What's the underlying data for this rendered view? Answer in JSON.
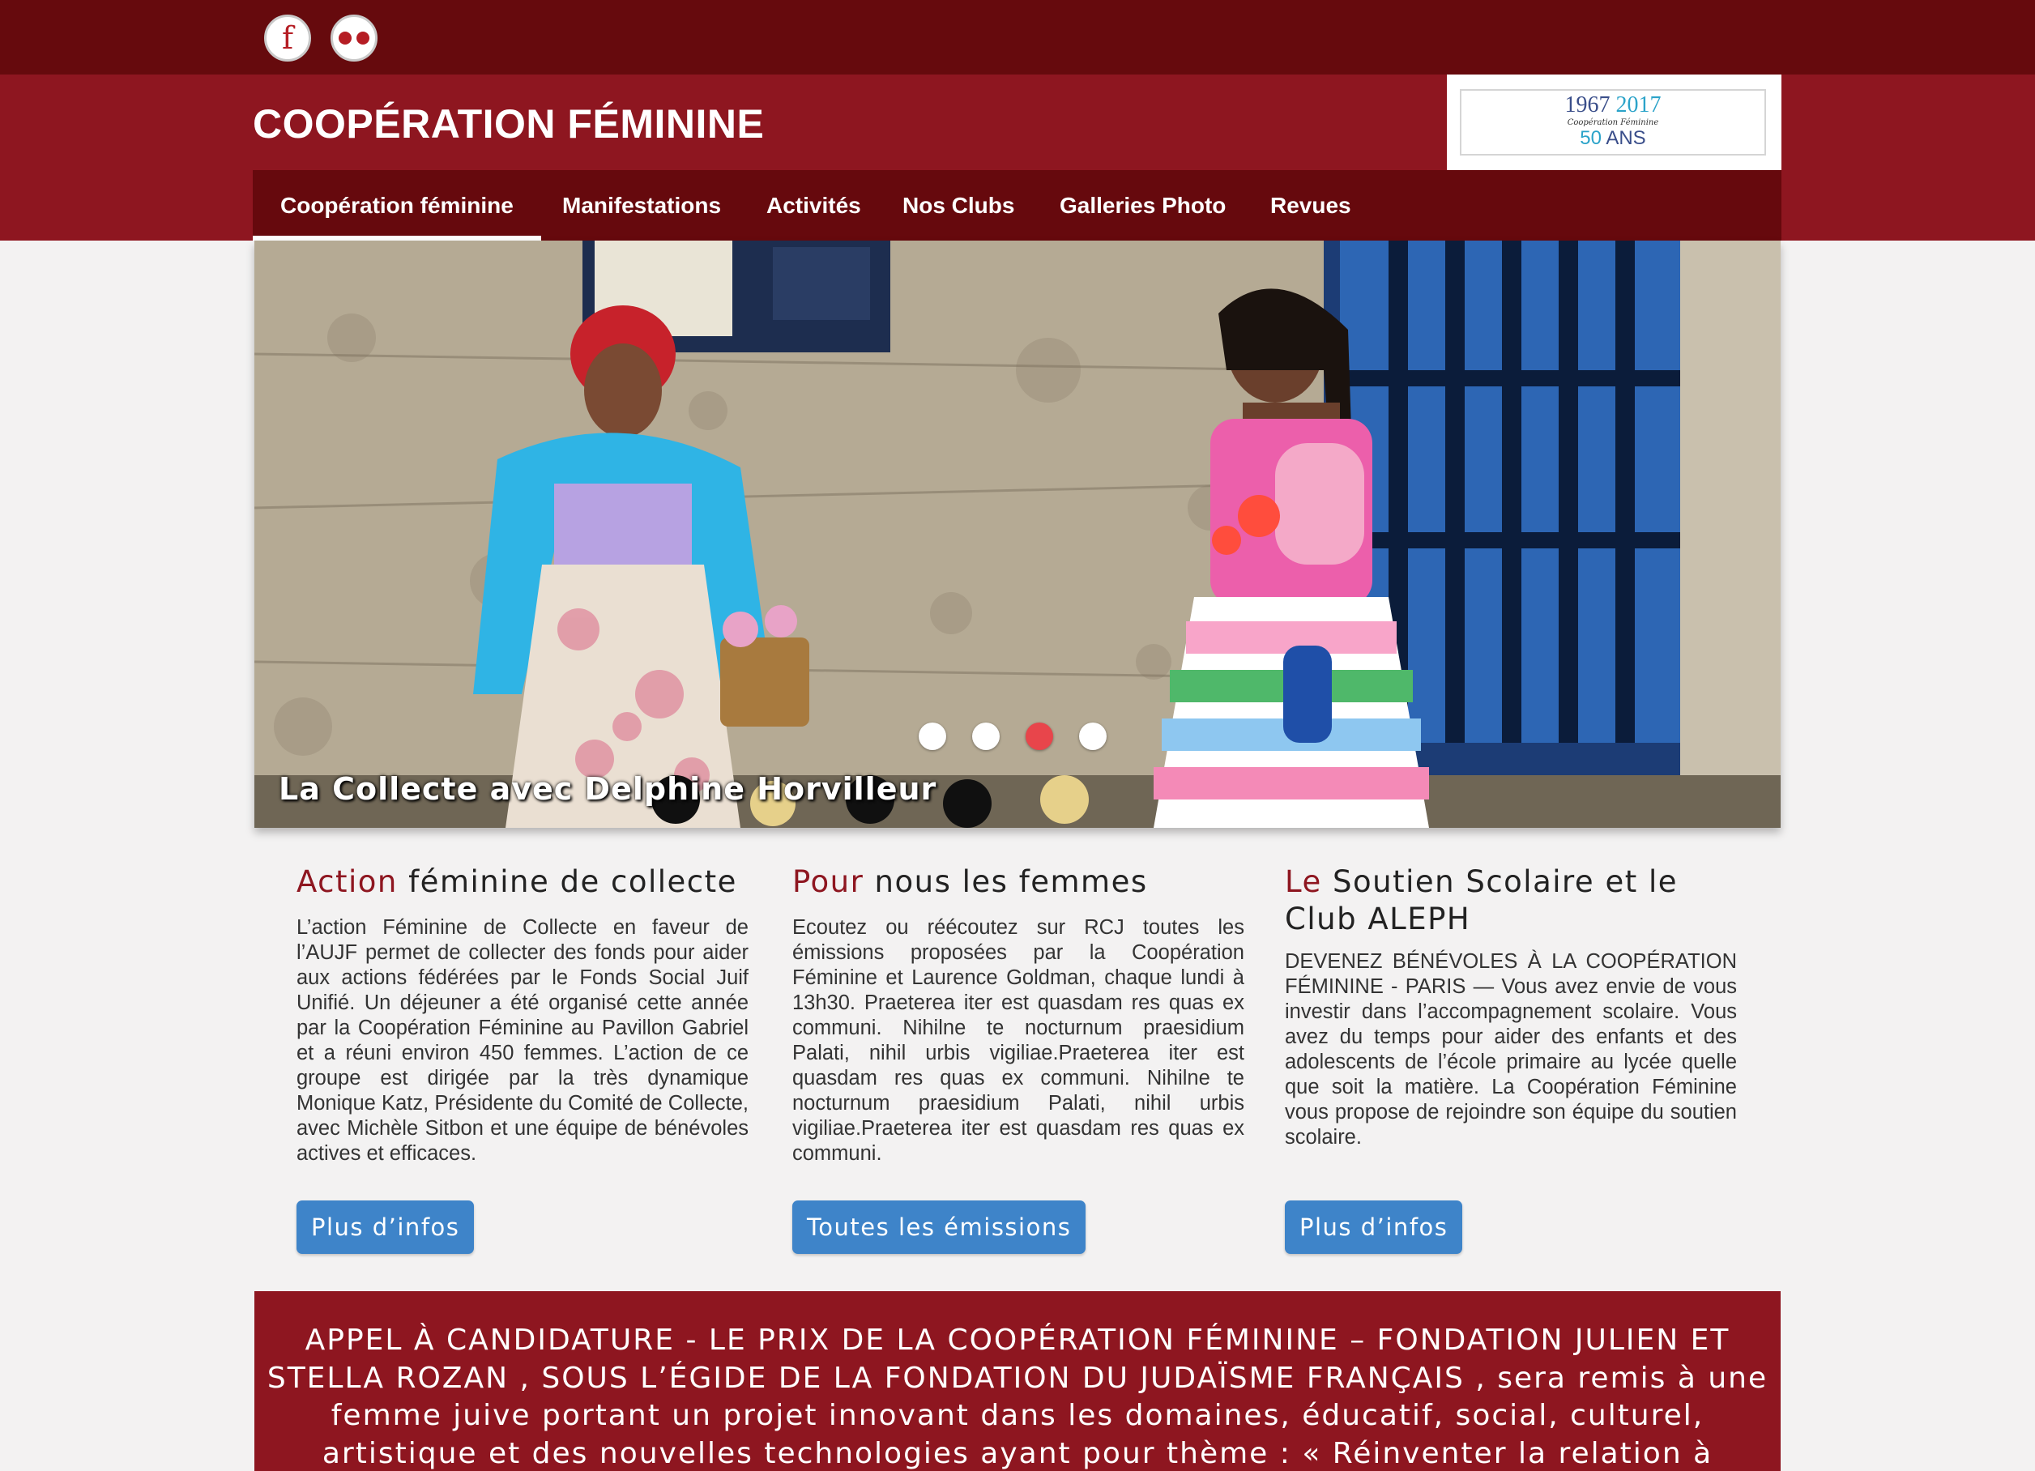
{
  "social": {
    "facebook_icon": "facebook-icon",
    "flickr_icon": "flickr-icon",
    "facebook_glyph": "f"
  },
  "header": {
    "site_title": "COOPÉRATION FÉMININE"
  },
  "logo": {
    "year_start": "1967",
    "year_end": "2017",
    "subtitle": "Coopération Féminine",
    "anniversary_number": "50",
    "anniversary_word": "ANS"
  },
  "nav": {
    "items": [
      {
        "label": "Coopération féminine",
        "active": true
      },
      {
        "label": "Manifestations",
        "active": false
      },
      {
        "label": "Activités",
        "active": false
      },
      {
        "label": "Nos Clubs",
        "active": false
      },
      {
        "label": "Galleries Photo",
        "active": false
      },
      {
        "label": "Revues",
        "active": false
      }
    ]
  },
  "slider": {
    "caption": "La Collecte avec Delphine Horvilleur",
    "slide_count": 4,
    "active_slide": 3
  },
  "columns": [
    {
      "title_accent": "Action",
      "title_rest": " féminine de collecte",
      "body": "L’action Féminine de Collecte en faveur de l’AUJF permet de collecter des fonds pour aider aux actions fédérées par le Fonds Social Juif Unifié. Un déjeuner a été organisé cette année par la Coopération Féminine au Pavillon Gabriel et a réuni environ 450 femmes. L’action de ce groupe est dirigée par la très dynamique Monique Katz, Présidente du Comité de Collecte, avec Michèle Sitbon et une équipe de bénévoles actives et efficaces.",
      "button": "Plus d’infos"
    },
    {
      "title_accent": "Pour",
      "title_rest": " nous les femmes",
      "body": "Ecoutez ou réécoutez sur RCJ toutes les émissions proposées par la Coopération Féminine et Laurence Goldman, chaque lundi à 13h30. Praeterea iter est quasdam res quas ex communi. Nihilne te nocturnum praesidium Palati, nihil urbis vigiliae.Praeterea iter est quasdam res quas ex communi. Nihilne te nocturnum praesidium Palati, nihil urbis vigiliae.Praeterea iter est quasdam res quas ex communi.",
      "button": "Toutes les émissions"
    },
    {
      "title_accent": "Le",
      "title_rest": " Soutien Scolaire et le Club ALEPH",
      "body": "DEVENEZ BÉNÉVOLES À LA COOPÉRATION FÉMININE - PARIS — Vous avez envie de vous investir dans l’accompagnement scolaire. Vous avez du temps pour aider des enfants et des adolescents de l’école primaire au lycée quelle que soit la matière. La Coopération Féminine vous propose de rejoindre son équipe du soutien scolaire.",
      "button": "Plus d’infos"
    }
  ],
  "banner": {
    "text": "APPEL À CANDIDATURE - LE PRIX DE LA COOPÉRATION FÉMININE – FONDATION JULIEN ET STELLA ROZAN , SOUS L’ÉGIDE DE LA FONDATION DU JUDAÏSME FRANÇAIS , sera remis à une femme juive portant un projet innovant dans les domaines, éducatif, social, culturel, artistique et des nouvelles technologies ayant pour thème : « Réinventer la relation à l’autre «. Montant"
  },
  "colors": {
    "top_strip": "#660a0d",
    "header": "#8e1620",
    "nav": "#66090d",
    "accent": "#8e1620",
    "button": "#3e84c9",
    "active_dot": "#e8454b"
  }
}
